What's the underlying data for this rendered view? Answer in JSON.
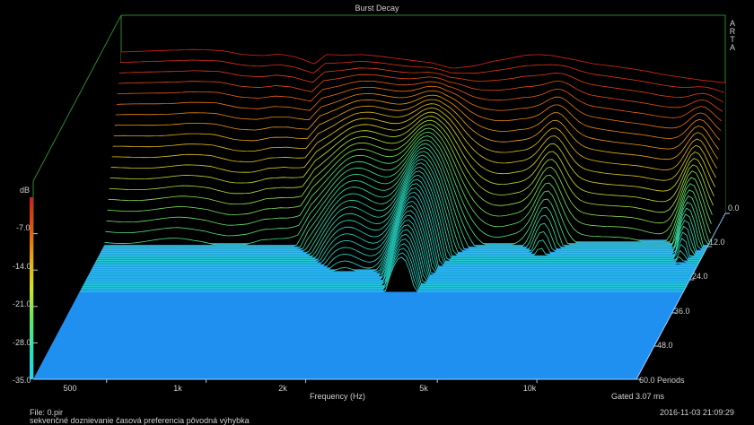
{
  "window": {
    "title": "Burst Decay",
    "brand_letters": [
      "A",
      "R",
      "T",
      "A"
    ]
  },
  "chart_data": {
    "type": "waterfall",
    "title": "Burst Decay",
    "xlabel": "Frequency (Hz)",
    "x_scale": "log",
    "xlim": [
      300,
      20000
    ],
    "x_ticks": [
      {
        "value": 500,
        "label": "500"
      },
      {
        "value": 1000,
        "label": "1k"
      },
      {
        "value": 2000,
        "label": "2k"
      },
      {
        "value": 5000,
        "label": "5k"
      },
      {
        "value": 10000,
        "label": "10k"
      }
    ],
    "ylabel": "dB",
    "ylim": [
      -35,
      0
    ],
    "y_ticks": [
      {
        "value": -7,
        "label": "-7.0"
      },
      {
        "value": -14,
        "label": "-14.0"
      },
      {
        "value": -21,
        "label": "-21.0"
      },
      {
        "value": -28,
        "label": "-28.0"
      },
      {
        "value": -35,
        "label": "-35.0"
      }
    ],
    "z_label": "Periods",
    "zlim": [
      0,
      60
    ],
    "z_ticks": [
      {
        "value": 0,
        "label": "0.0"
      },
      {
        "value": 12,
        "label": "12.0"
      },
      {
        "value": 24,
        "label": "24.0"
      },
      {
        "value": 36,
        "label": "36.0"
      },
      {
        "value": 48,
        "label": "48.0"
      },
      {
        "value": 60,
        "label": "60.0 Periods"
      }
    ],
    "slice_count": 60,
    "front_spectrum": {
      "x": [
        300,
        400,
        500,
        600,
        700,
        800,
        900,
        1000,
        1150,
        1250,
        1400,
        1600,
        1800,
        2000,
        2300,
        2600,
        3000,
        3500,
        4000,
        4500,
        5000,
        5500,
        6000,
        7000,
        8000,
        9000,
        10000,
        11500,
        13000,
        15000,
        17000,
        20000
      ],
      "y": [
        -3.5,
        -3.2,
        -3.0,
        -3.2,
        -4.0,
        -4.2,
        -3.9,
        -4.4,
        -5.8,
        -4.0,
        -4.1,
        -4.0,
        -4.3,
        -4.7,
        -5.2,
        -5.6,
        -6.7,
        -6.2,
        -5.3,
        -4.7,
        -4.1,
        -4.0,
        -4.2,
        -5.0,
        -5.8,
        -6.2,
        -6.6,
        -7.2,
        -7.9,
        -8.5,
        -9.0,
        -9.5
      ]
    },
    "color_scale": [
      "#1fd4ff",
      "#2be0c0",
      "#66e860",
      "#d8e020",
      "#f0a010",
      "#e85010",
      "#d81a1a"
    ]
  },
  "footer": {
    "gated": "Gated 3.07 ms",
    "file": "File: 0.pir",
    "description": "sekvenčné doznievanie časová  preferencia pôvodná výhybka",
    "datetime": "2016-11-03  21:09:29"
  }
}
